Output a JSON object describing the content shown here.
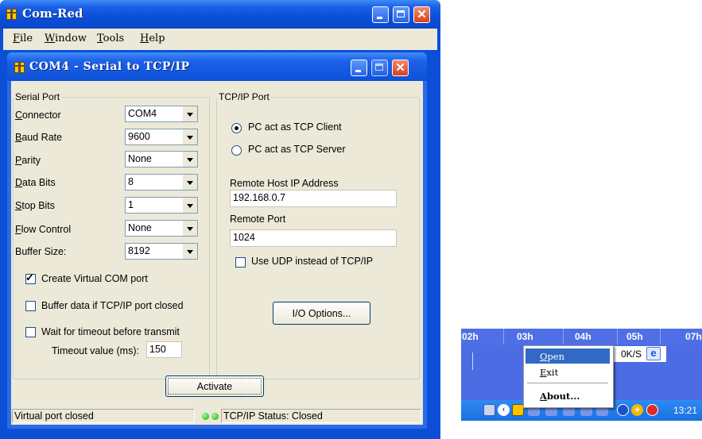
{
  "app": {
    "title": "Com-Red",
    "menu": [
      {
        "mnemonic": "F",
        "rest": "ile"
      },
      {
        "mnemonic": "W",
        "rest": "indow"
      },
      {
        "mnemonic": "T",
        "rest": "ools"
      },
      {
        "mnemonic": "H",
        "rest": "elp"
      }
    ]
  },
  "child": {
    "title": "COM4 - Serial to TCP/IP"
  },
  "serial_port": {
    "group_title": "Serial Port",
    "fields": [
      {
        "mnemonic": "C",
        "rest": "onnector",
        "value": "COM4"
      },
      {
        "mnemonic": "B",
        "rest": "aud Rate",
        "value": "9600"
      },
      {
        "mnemonic": "P",
        "rest": "arity",
        "value": "None"
      },
      {
        "mnemonic": "D",
        "rest": "ata Bits",
        "value": "8"
      },
      {
        "mnemonic": "S",
        "rest": "top Bits",
        "value": "1"
      },
      {
        "mnemonic": "F",
        "rest": "low Control",
        "value": "None"
      },
      {
        "mnemonic": "",
        "rest": "Buffer Size:",
        "value": "8192"
      }
    ],
    "create_virtual": {
      "label": "Create Virtual COM port",
      "checked": true
    },
    "buffer_data": {
      "label": "Buffer data if TCP/IP port closed",
      "checked": false
    },
    "wait_timeout": {
      "label": "Wait for timeout before transmit",
      "checked": false
    },
    "timeout_label": "Timeout value (ms):",
    "timeout_value": "150"
  },
  "tcp_port": {
    "group_title": "TCP/IP Port",
    "client_label": "PC act as TCP Client",
    "server_label": "PC act as TCP Server",
    "selected": "client",
    "host_label": "Remote Host IP Address",
    "host_value": "192.168.0.7",
    "port_label": "Remote Port",
    "port_value": "1024",
    "udp_label": "Use UDP instead of TCP/IP",
    "udp_checked": false,
    "io_button": "I/O Options..."
  },
  "activate_button": "Activate",
  "status": {
    "left": "Virtual port closed",
    "right": "TCP/IP Status: Closed"
  },
  "tray": {
    "hours": [
      "02h",
      "03h",
      "04h",
      "05h",
      "07h"
    ],
    "speed": "0K/S",
    "clock": "13:21",
    "menu": [
      {
        "mnemonic": "O",
        "rest": "pen",
        "highlighted": true
      },
      {
        "mnemonic": "E",
        "rest": "xit",
        "highlighted": false
      },
      {
        "mnemonic": "A",
        "rest": "bout...",
        "highlighted": false
      }
    ]
  },
  "colors": {
    "xp_blue": "#0b4fd6",
    "dialog_bg": "#ece9d8",
    "menu_highlight": "#316ac5",
    "close_red": "#d8401c"
  }
}
